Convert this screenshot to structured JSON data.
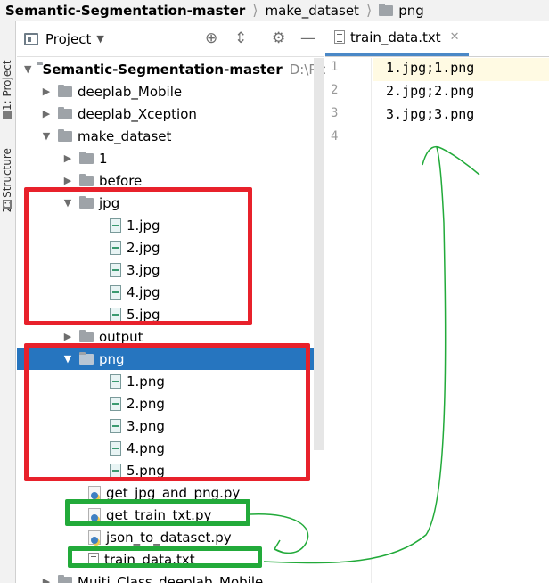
{
  "breadcrumb": {
    "project": "Semantic-Segmentation-master",
    "folder1": "make_dataset",
    "folder2": "png"
  },
  "side_tabs": {
    "project": "1: Project",
    "structure": "Z: Structure"
  },
  "project_panel": {
    "title": "Project",
    "root": {
      "name": "Semantic-Segmentation-master",
      "path": "D:\\Pro"
    },
    "items": [
      {
        "label": "deeplab_Mobile"
      },
      {
        "label": "deeplab_Xception"
      },
      {
        "label": "make_dataset"
      },
      {
        "label": "1"
      },
      {
        "label": "before"
      },
      {
        "label": "jpg"
      },
      {
        "label": "1.jpg"
      },
      {
        "label": "2.jpg"
      },
      {
        "label": "3.jpg"
      },
      {
        "label": "4.jpg"
      },
      {
        "label": "5.jpg"
      },
      {
        "label": "output"
      },
      {
        "label": "png"
      },
      {
        "label": "1.png"
      },
      {
        "label": "2.png"
      },
      {
        "label": "3.png"
      },
      {
        "label": "4.png"
      },
      {
        "label": "5.png"
      },
      {
        "label": "get_jpg_and_png.py"
      },
      {
        "label": "get_train_txt.py"
      },
      {
        "label": "json_to_dataset.py"
      },
      {
        "label": "train_data.txt"
      },
      {
        "label": "Muiti_Class_deeplab_Mobile"
      }
    ]
  },
  "editor": {
    "tab_label": "train_data.txt",
    "line_numbers": [
      "1",
      "2",
      "3",
      "4"
    ],
    "lines": [
      "1.jpg;1.png",
      "2.jpg;2.png",
      "3.jpg;3.png",
      ""
    ]
  },
  "colors": {
    "selection": "#2675bf",
    "annotation_red": "#e8212b",
    "annotation_green": "#22aa3a"
  }
}
